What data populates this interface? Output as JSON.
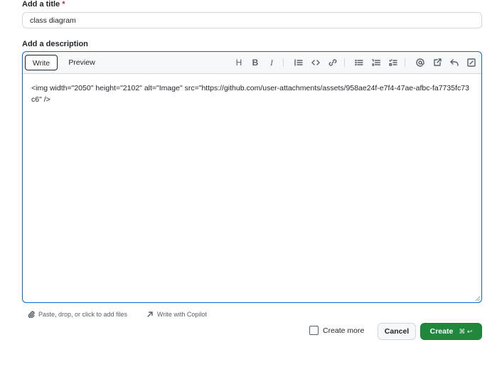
{
  "title_field": {
    "label": "Add a title",
    "required_mark": "*",
    "value": "class diagram"
  },
  "description": {
    "label": "Add a description",
    "tabs": [
      {
        "label": "Write",
        "active": true
      },
      {
        "label": "Preview",
        "active": false
      }
    ],
    "toolbar": {
      "heading": "H",
      "bold": "B",
      "italic": "I"
    },
    "body": "<img width=\"2050\" height=\"2102\" alt=\"Image\" src=\"https://github.com/user-attachments/assets/958ae24f-e7f4-47ae-afbc-fa7735fc73c6\" />"
  },
  "footer": {
    "attach_hint": "Paste, drop, or click to add files",
    "copilot_hint": "Write with Copilot"
  },
  "actions": {
    "create_more_label": "Create more",
    "cancel_label": "Cancel",
    "create_label": "Create",
    "create_shortcut": "⌘ ↩"
  },
  "colors": {
    "accent": "#0969da",
    "create_button": "#1f883d",
    "required": "#d1242f"
  }
}
